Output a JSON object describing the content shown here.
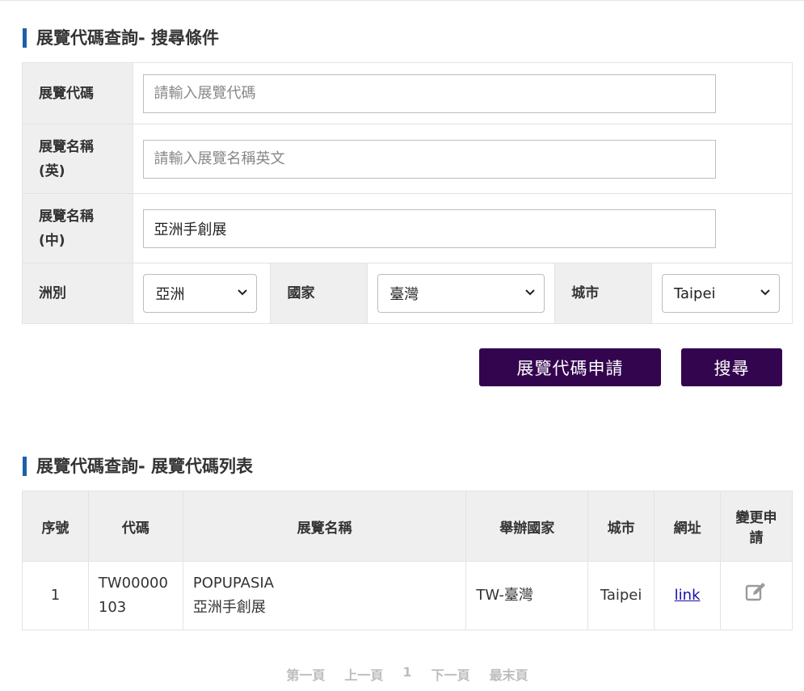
{
  "search_section": {
    "title": "展覽代碼查詢- 搜尋條件",
    "fields": {
      "code_label": "展覽代碼",
      "code_placeholder": "請輸入展覽代碼",
      "name_en_label_line1": "展覽名稱",
      "name_en_label_line2": "(英)",
      "name_en_placeholder": "請輸入展覽名稱英文",
      "name_zh_label_line1": "展覽名稱",
      "name_zh_label_line2": "(中)",
      "name_zh_value": "亞洲手創展",
      "continent_label": "洲別",
      "continent_value": "亞洲",
      "country_label": "國家",
      "country_value": "臺灣",
      "city_label": "城市",
      "city_value": "Taipei"
    },
    "apply_button": "展覽代碼申請",
    "search_button": "搜尋"
  },
  "list_section": {
    "title": "展覽代碼查詢- 展覽代碼列表",
    "headers": {
      "index": "序號",
      "code": "代碼",
      "name": "展覽名稱",
      "country": "舉辦國家",
      "city": "城市",
      "url": "網址",
      "change_line1": "變更申",
      "change_line2": "請"
    },
    "rows": [
      {
        "index": "1",
        "code_line1": "TW00000",
        "code_line2": "103",
        "name_en": "POPUPASIA",
        "name_zh": "亞洲手創展",
        "country": "TW-臺灣",
        "city": "Taipei",
        "url_text": "link",
        "change_icon": "edit-icon"
      }
    ]
  },
  "pagination": {
    "first": "第一頁",
    "prev": "上一頁",
    "current": "1",
    "next": "下一頁",
    "last": "最末頁"
  },
  "colors": {
    "accent_bar": "#1d5fa8",
    "button_bg": "#34054f",
    "label_bg": "#efefef"
  }
}
